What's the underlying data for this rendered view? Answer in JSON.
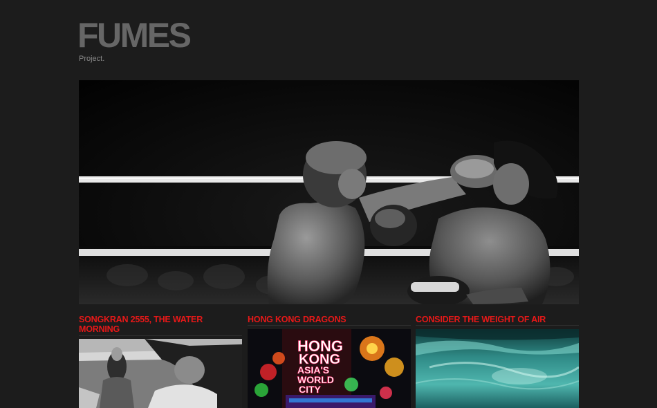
{
  "site": {
    "logo": "FUMES",
    "tagline": "Project."
  },
  "hero": {
    "image": "muay-thai-boxing-photo"
  },
  "posts": [
    {
      "title": "SONGKRAN 2555, THE WATER MORNING",
      "image": "songkran-buddha-statue-photo"
    },
    {
      "title": "HONG KONG DRAGONS",
      "image": "hong-kong-neon-sign-photo",
      "sign_lines": [
        "HONG",
        "KONG",
        "ASIA'S",
        "WORLD",
        "CITY"
      ]
    },
    {
      "title": "CONSIDER THE WEIGHT OF AIR",
      "image": "ocean-wave-photo"
    }
  ],
  "colors": {
    "background": "#1c1c1c",
    "logo": "#666666",
    "post_title": "#e81818"
  }
}
